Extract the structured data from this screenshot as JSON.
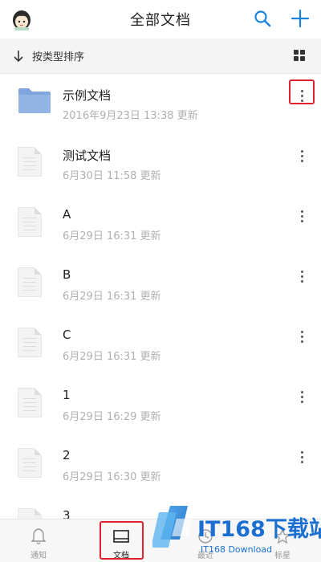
{
  "header": {
    "title": "全部文档",
    "avatar_icon": "avatar-icon",
    "search_icon": "search-icon",
    "add_icon": "plus-icon"
  },
  "sortbar": {
    "label": "按类型排序",
    "sort_icon": "arrow-down-icon",
    "view_icon": "grid-view-icon"
  },
  "files": [
    {
      "name": "示例文档",
      "time": "2016年9月23日 13:38 更新",
      "type": "folder"
    },
    {
      "name": "测试文档",
      "time": "6月30日 11:58 更新",
      "type": "doc"
    },
    {
      "name": "A",
      "time": "6月29日 16:31 更新",
      "type": "doc"
    },
    {
      "name": "B",
      "time": "6月29日 16:31 更新",
      "type": "doc"
    },
    {
      "name": "C",
      "time": "6月29日 16:31 更新",
      "type": "doc"
    },
    {
      "name": "1",
      "time": "6月29日 16:29 更新",
      "type": "doc"
    },
    {
      "name": "2",
      "time": "6月29日 16:30 更新",
      "type": "doc"
    },
    {
      "name": "3",
      "time": "",
      "type": "doc"
    }
  ],
  "tabbar": {
    "tabs": [
      {
        "label": "通知",
        "icon": "bell-icon",
        "active": false
      },
      {
        "label": "文档",
        "icon": "document-icon",
        "active": true
      },
      {
        "label": "最近",
        "icon": "clock-icon",
        "active": false
      },
      {
        "label": "标星",
        "icon": "star-icon",
        "active": false
      }
    ]
  },
  "watermark": {
    "brand": "IT168下载站",
    "sub": "IT168 Download"
  },
  "colors": {
    "accent": "#1a82e2",
    "highlight": "#e0222e",
    "folder": "#8fb2e3"
  }
}
